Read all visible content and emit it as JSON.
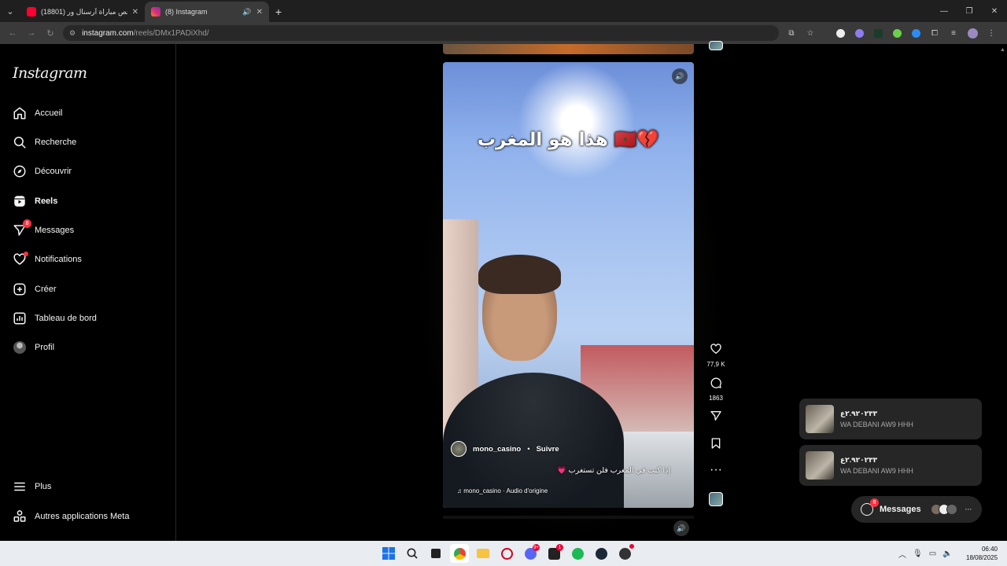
{
  "browser": {
    "tabs": [
      {
        "title": "(18801) ملخص مباراة آرسنال ور",
        "favicon_color": "#ff0033",
        "active": false
      },
      {
        "title": "(8) Instagram",
        "favicon_color": "#dd2a7b",
        "active": true
      }
    ],
    "url_host": "instagram.com",
    "url_path": "/reels/DMx1PADiXhd/"
  },
  "sidebar": {
    "logo": "Instagram",
    "items": [
      {
        "label": "Accueil",
        "icon": "home-icon"
      },
      {
        "label": "Recherche",
        "icon": "search-icon"
      },
      {
        "label": "Découvrir",
        "icon": "compass-icon"
      },
      {
        "label": "Reels",
        "icon": "reels-icon"
      },
      {
        "label": "Messages",
        "icon": "messenger-icon",
        "badge": "8"
      },
      {
        "label": "Notifications",
        "icon": "heart-icon"
      },
      {
        "label": "Créer",
        "icon": "plus-square-icon"
      },
      {
        "label": "Tableau de bord",
        "icon": "dashboard-icon"
      },
      {
        "label": "Profil",
        "icon": "avatar"
      }
    ],
    "bottom": [
      {
        "label": "Plus",
        "icon": "menu-icon"
      },
      {
        "label": "Autres applications Meta",
        "icon": "meta-apps-icon"
      }
    ]
  },
  "reel": {
    "overlay_title": "هذا هو المغرب 🇲🇦💔",
    "username": "mono_casino",
    "separator": "•",
    "follow": "Suivre",
    "caption": "إذا كنت في المغرب فلن تستغرب 💗",
    "audio": "mono_casino · Audio d'origine"
  },
  "actions": {
    "likes": "77,9 K",
    "comments": "1863"
  },
  "notifications": [
    {
      "title": "٢.٩٢٠٢٣٣ع",
      "text": "WA DEBANI AW9 HHH"
    },
    {
      "title": "٢.٩٢٠٢٣٣ع",
      "text": "WA DEBANI AW9 HHH"
    }
  ],
  "messages_pill": {
    "label": "Messages",
    "badge": "8",
    "more": "···"
  },
  "taskbar": {
    "time": "06:40",
    "date": "18/08/2025",
    "discord_badge": "9+",
    "app_badge": "1"
  }
}
